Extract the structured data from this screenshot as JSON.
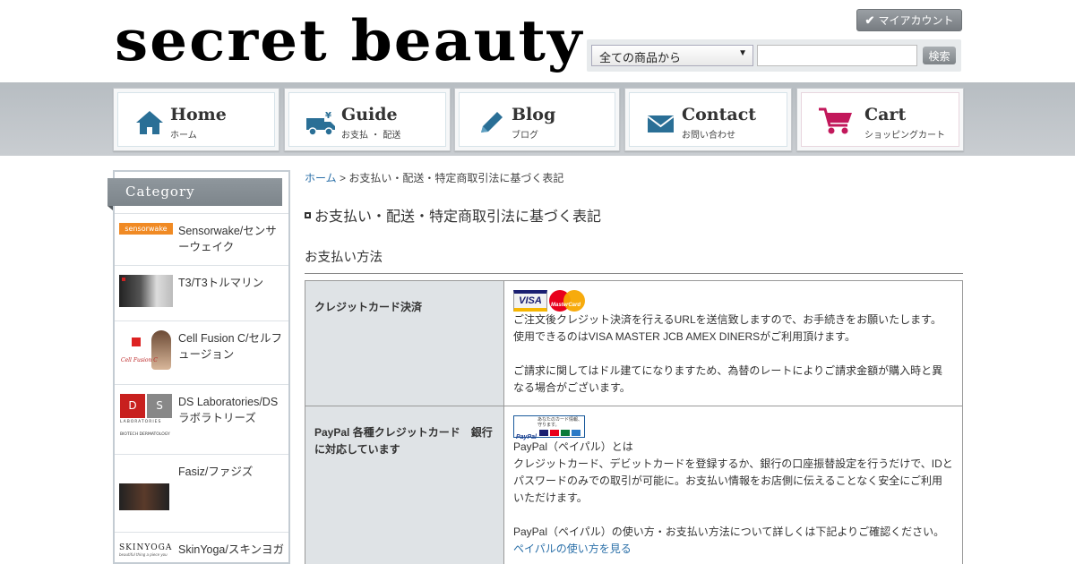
{
  "header": {
    "logo_text": "secret beauty",
    "mypage_label": "マイアカウント",
    "search": {
      "select_value": "全ての商品から",
      "input_value": "",
      "button_label": "検索"
    }
  },
  "nav": {
    "items": [
      {
        "title": "Home",
        "sub": "ホーム",
        "icon": "home-icon"
      },
      {
        "title": "Guide",
        "sub": "お支払 ・ 配送",
        "icon": "delivery-truck-icon"
      },
      {
        "title": "Blog",
        "sub": "ブログ",
        "icon": "pencil-icon"
      },
      {
        "title": "Contact",
        "sub": "お問い合わせ",
        "icon": "envelope-icon"
      },
      {
        "title": "Cart",
        "sub": "ショッピングカート",
        "icon": "cart-icon"
      }
    ]
  },
  "sidebar": {
    "header": "Category",
    "items": [
      {
        "label": "Sensorwake/センサーウェイク",
        "thumb_text": "sensorwake"
      },
      {
        "label": "T3/T3トルマリン",
        "thumb_text": ""
      },
      {
        "label": "Cell Fusion C/セルフュージョン",
        "thumb_text": "Cell Fusion C"
      },
      {
        "label": "DS Laboratories/DSラボラトリーズ",
        "thumb_text": "D S LABORATORIES BIOTECH DERMATOLOGY"
      },
      {
        "label": "Fasiz/ファジズ",
        "thumb_text": ""
      },
      {
        "label": "SkinYoga/スキンヨガ",
        "thumb_text": "SKINYOGA beautiful thing a piece you"
      }
    ]
  },
  "main": {
    "breadcrumb_home": "ホーム",
    "breadcrumb_sep": ">",
    "breadcrumb_current": "お支払い・配送・特定商取引法に基づく表記",
    "page_title": "お支払い・配送・特定商取引法に基づく表記",
    "section_title": "お支払い方法",
    "payments": [
      {
        "method": "クレジットカード決済",
        "logos": [
          "VISA",
          "MasterCard"
        ],
        "lines": [
          "ご注文後クレジット決済を行えるURLを送信致しますので、お手続きをお願いたします。",
          "使用できるのはVISA MASTER JCB AMEX DINERSがご利用頂けます。",
          "",
          "ご請求に関してはドル建てになりますため、為替のレートによりご請求金額が購入時と異なる場合がございます。"
        ]
      },
      {
        "method": "PayPal 各種クレジットカード　銀行に対応しています",
        "badge_text": "あなたのカード情報、守ります。",
        "badge_brand": "PayPal",
        "lines": [
          "PayPal（ペイパル）とは",
          "クレジットカード、デビットカードを登録するか、銀行の口座振替設定を行うだけで、IDとパスワードのみでの取引が可能に。お支払い情報をお店側に伝えることなく安全にご利用いただけます。",
          "",
          "PayPal（ペイパル）の使い方・お支払い方法について詳しくは下記よりご確認ください。"
        ],
        "link": "ペイパルの使い方を見る"
      }
    ]
  },
  "colors": {
    "nav_icon_blue": "#2a6f96",
    "cart_pink": "#c2185b",
    "link_blue": "#2a6fa8",
    "th_bg": "#dfe3e6"
  }
}
